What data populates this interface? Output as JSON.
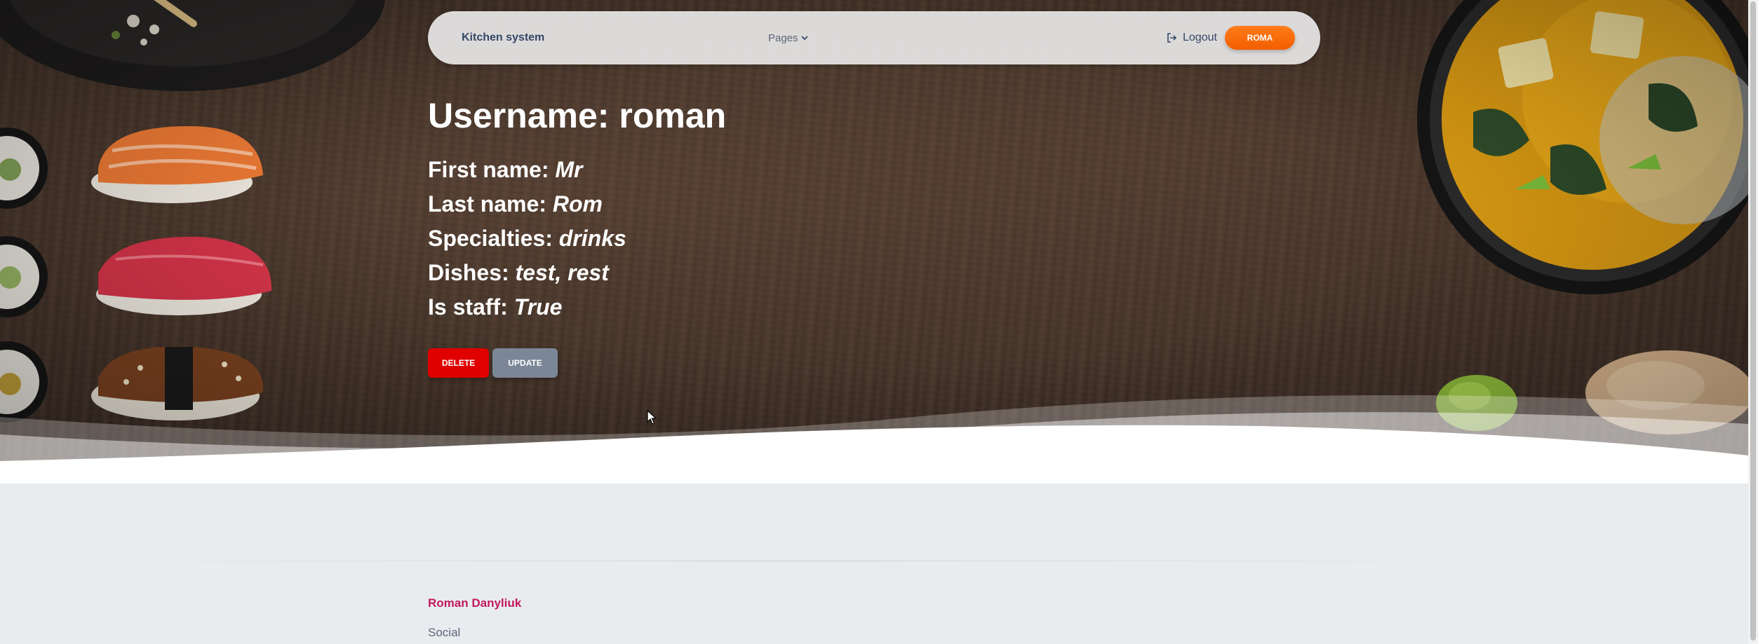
{
  "navbar": {
    "brand": "Kitchen system",
    "pages_label": "Pages",
    "logout_label": "Logout",
    "user_button_label": "ROMA"
  },
  "profile": {
    "username_label": "Username:",
    "username": "roman",
    "fields": [
      {
        "label": "First name:",
        "value": "Mr"
      },
      {
        "label": "Last name:",
        "value": "Rom"
      },
      {
        "label": "Specialties:",
        "value": "drinks"
      },
      {
        "label": "Dishes:",
        "value": "test, rest"
      },
      {
        "label": "Is staff:",
        "value": "True"
      }
    ]
  },
  "actions": {
    "delete_label": "DELETE",
    "update_label": "UPDATE"
  },
  "footer": {
    "name": "Roman Danyliuk",
    "social": "Social"
  },
  "colors": {
    "accent_orange": "#f25e00",
    "delete_red": "#e00000",
    "update_gray": "#7b8797",
    "footer_name": "#c2185b"
  },
  "icons": {
    "pages_caret": "chevron-down-icon",
    "logout": "logout-icon",
    "cursor": "mouse-cursor-icon"
  }
}
